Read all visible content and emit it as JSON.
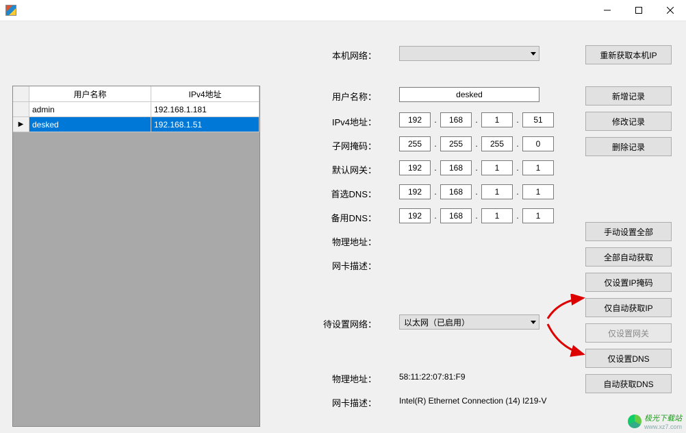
{
  "window": {
    "title": ""
  },
  "win_controls": {
    "minimize": "—",
    "maximize": "□",
    "close": "×"
  },
  "grid": {
    "headers": {
      "username": "用户名称",
      "ipv4": "IPv4地址"
    },
    "rows": [
      {
        "username": "admin",
        "ipv4": "192.168.1.181",
        "selected": false
      },
      {
        "username": "desked",
        "ipv4": "192.168.1.51",
        "selected": true
      }
    ]
  },
  "labels": {
    "local_network": "本机网络：",
    "username": "用户名称：",
    "ipv4": "IPv4地址：",
    "subnet": "子网掩码：",
    "gateway": "默认网关：",
    "dns1": "首选DNS：",
    "dns2": "备用DNS：",
    "mac": "物理地址：",
    "nic_desc": "网卡描述：",
    "target_network": "待设置网络：",
    "mac2": "物理地址：",
    "nic_desc2": "网卡描述："
  },
  "fields": {
    "local_network": "",
    "username": "desked",
    "ipv4": [
      "192",
      "168",
      "1",
      "51"
    ],
    "subnet": [
      "255",
      "255",
      "255",
      "0"
    ],
    "gateway": [
      "192",
      "168",
      "1",
      "1"
    ],
    "dns1": [
      "192",
      "168",
      "1",
      "1"
    ],
    "dns2": [
      "192",
      "168",
      "1",
      "1"
    ],
    "target_network": "以太网（已启用）",
    "mac2": "58:11:22:07:81:F9",
    "nic_desc2": "Intel(R) Ethernet Connection (14) I219-V"
  },
  "buttons": {
    "refresh_local_ip": "重新获取本机IP",
    "add_record": "新增记录",
    "modify_record": "修改记录",
    "delete_record": "删除记录",
    "set_all_manual": "手动设置全部",
    "set_all_auto": "全部自动获取",
    "set_ip_mask_only": "仅设置IP掩码",
    "auto_ip_only": "仅自动获取IP",
    "set_gateway_only": "仅设置网关",
    "set_dns_only": "仅设置DNS",
    "auto_dns": "自动获取DNS"
  },
  "watermark": {
    "name": "极光下载站",
    "url": "www.xz7.com"
  }
}
